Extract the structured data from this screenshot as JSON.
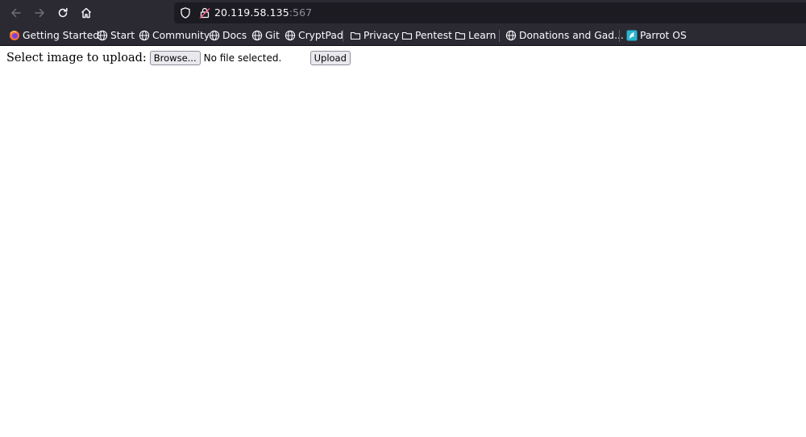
{
  "browser": {
    "nav": {
      "back_icon": "arrow-left-icon",
      "forward_icon": "arrow-right-icon",
      "reload_icon": "reload-icon",
      "home_icon": "home-icon"
    },
    "url": {
      "host": "20.119.58.135",
      "port": ":567"
    },
    "bookmarks": [
      {
        "label": "Getting Started",
        "icon": "firefox-icon"
      },
      {
        "label": "Start",
        "icon": "globe-icon"
      },
      {
        "label": "Community",
        "icon": "globe-icon"
      },
      {
        "label": "Docs",
        "icon": "globe-icon"
      },
      {
        "label": "Git",
        "icon": "globe-icon"
      },
      {
        "label": "CryptPad",
        "icon": "globe-icon"
      },
      {
        "label": "Privacy",
        "icon": "folder-icon"
      },
      {
        "label": "Pentest",
        "icon": "folder-icon"
      },
      {
        "label": "Learn",
        "icon": "folder-icon"
      },
      {
        "label": "Donations and Gad...",
        "icon": "globe-icon"
      },
      {
        "label": "Parrot OS",
        "icon": "parrot-icon"
      }
    ],
    "colors": {
      "chrome_bg": "#2b2a33",
      "urlbar_bg": "#1c1b22",
      "text": "#fbfbfe"
    }
  },
  "page": {
    "label": "Select image to upload:",
    "browse_label": "Browse...",
    "file_status": "No file selected.",
    "upload_label": "Upload"
  }
}
